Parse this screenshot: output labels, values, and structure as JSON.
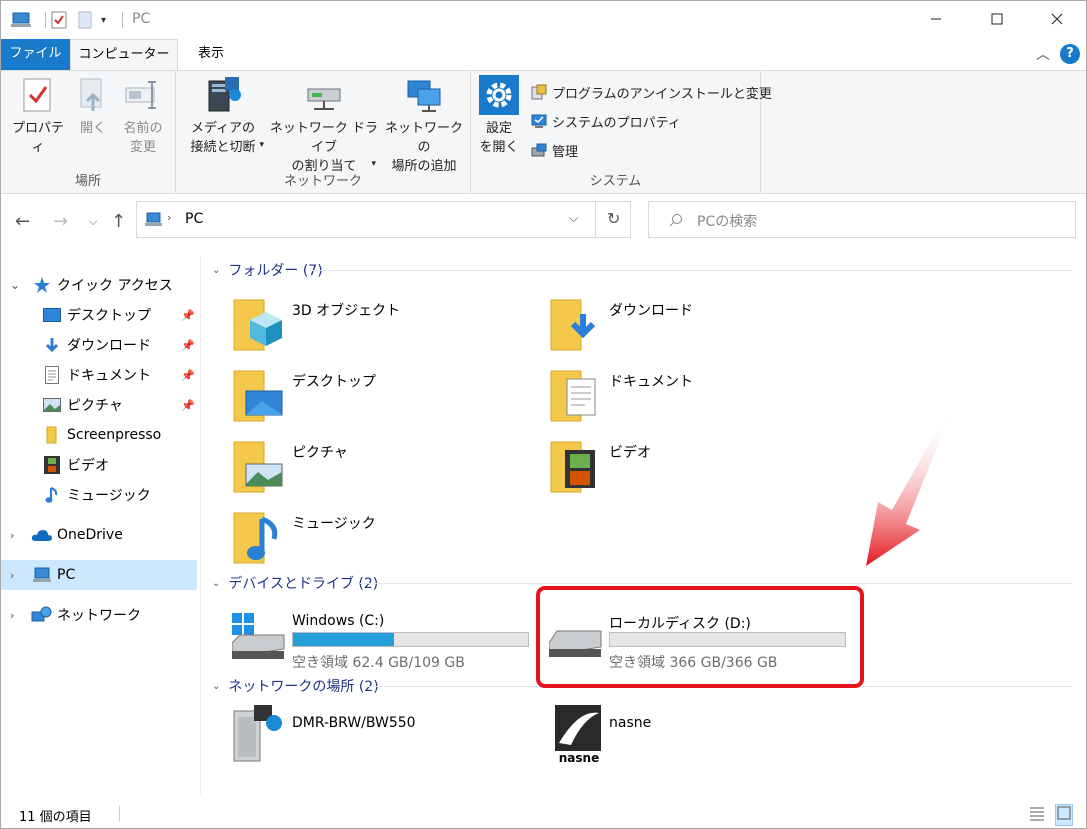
{
  "window": {
    "title": "PC"
  },
  "tabs": {
    "file": "ファイル",
    "computer": "コンピューター",
    "view": "表示"
  },
  "ribbon": {
    "location_group": "場所",
    "network_group": "ネットワーク",
    "system_group": "システム",
    "properties": "プロパティ",
    "open": "開く",
    "rename": "名前の\n変更",
    "media": "メディアの\n接続と切断",
    "map_drive": "ネットワーク ドライブ\nの割り当て",
    "add_location": "ネットワークの\n場所の追加",
    "settings": "設定\nを開く",
    "uninstall": "プログラムのアンインストールと変更",
    "sys_props": "システムのプロパティ",
    "manage": "管理"
  },
  "address": {
    "path": "PC",
    "search_placeholder": "PCの検索"
  },
  "navpane": {
    "quick_access": "クイック アクセス",
    "desktop": "デスクトップ",
    "downloads": "ダウンロード",
    "documents": "ドキュメント",
    "pictures": "ピクチャ",
    "screenpresso": "Screenpresso",
    "videos": "ビデオ",
    "music": "ミュージック",
    "onedrive": "OneDrive",
    "pc": "PC",
    "network": "ネットワーク"
  },
  "sections": {
    "folders": "フォルダー (7)",
    "devices": "デバイスとドライブ (2)",
    "netlocs": "ネットワークの場所 (2)"
  },
  "folders": {
    "f3d": "3D オブジェクト",
    "downloads": "ダウンロード",
    "desktop": "デスクトップ",
    "documents": "ドキュメント",
    "pictures": "ピクチャ",
    "videos": "ビデオ",
    "music": "ミュージック"
  },
  "drives": {
    "c": {
      "name": "Windows (C:)",
      "free": "空き領域 62.4 GB/109 GB",
      "used_fraction": 0.43
    },
    "d": {
      "name": "ローカルディスク (D:)",
      "free": "空き領域 366 GB/366 GB",
      "used_fraction": 0.0
    }
  },
  "netlocs": {
    "dmr": "DMR-BRW/BW550",
    "nasne": "nasne",
    "nasne_logo": "nasne"
  },
  "status": {
    "count": "11 個の項目"
  }
}
